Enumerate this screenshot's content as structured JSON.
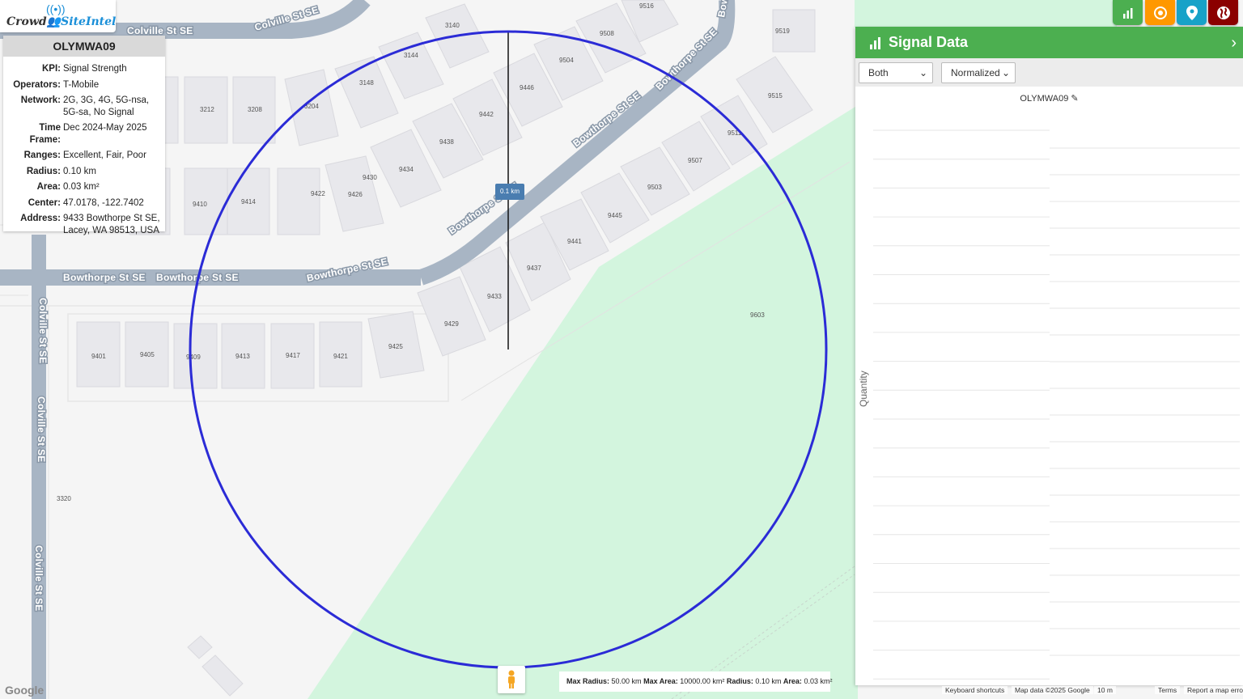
{
  "app": {
    "logo_left": "Crowd",
    "logo_right": "SiteIntel"
  },
  "info": {
    "title": "OLYMWA09",
    "rows": [
      {
        "k": "KPI:",
        "v": "Signal Strength"
      },
      {
        "k": "Operators:",
        "v": "T-Mobile"
      },
      {
        "k": "Network:",
        "v": "2G, 3G, 4G, 5G-nsa, 5G-sa, No Signal"
      },
      {
        "k": "Time Frame:",
        "v": "Dec 2024-May 2025"
      },
      {
        "k": "Ranges:",
        "v": "Excellent, Fair, Poor"
      },
      {
        "k": "Radius:",
        "v": "0.10 km"
      },
      {
        "k": "Area:",
        "v": "0.03 km²"
      },
      {
        "k": "Center:",
        "v": "47.0178, -122.7402"
      },
      {
        "k": "Address:",
        "v": "9433 Bowthorpe St SE, Lacey, WA 98513, USA"
      }
    ]
  },
  "toolbar": {
    "buttons": [
      {
        "name": "chart-icon",
        "color": "#4caf50"
      },
      {
        "name": "target-icon",
        "color": "#ff9800"
      },
      {
        "name": "location-pin-icon",
        "color": "#17a2c8"
      },
      {
        "name": "globe-icon",
        "color": "#8b0000"
      }
    ]
  },
  "panel": {
    "title": "Signal Data",
    "select_mode": "Both",
    "select_scale": "Normalized",
    "chart_title": "OLYMWA09",
    "ylabel": "Quantity"
  },
  "map": {
    "streets": {
      "colville_top_1": "Colville St SE",
      "colville_top_2": "Colville St SE",
      "bowthorpe_1": "Bowthorpe St SE",
      "bowthorpe_2": "Bowthorpe St SE",
      "bowthorpe_3": "Bowthorpe St SE",
      "bowthorpe_diag_1": "Bowthorpe St SE",
      "bowthorpe_diag_2": "Bowthorpe St SE",
      "bowthorpe_diag_3": "Bowthorpe St SE",
      "bowthorpe_vert": "Bow",
      "colville_vert_1": "Colville St SE",
      "colville_vert_2": "Colville St SE",
      "colville_vert_3": "Colville St SE"
    },
    "measure_label": "0.1 km",
    "house_numbers": [
      "3140",
      "3144",
      "3148",
      "3204",
      "3212",
      "3208",
      "9516",
      "9508",
      "9504",
      "9446",
      "9442",
      "9438",
      "9434",
      "9430",
      "9426",
      "9422",
      "9414",
      "9410",
      "9519",
      "9515",
      "9511",
      "9507",
      "9503",
      "9445",
      "9441",
      "9437",
      "9433",
      "9429",
      "9425",
      "9421",
      "9417",
      "9413",
      "9409",
      "9405",
      "9401",
      "9603",
      "3320"
    ]
  },
  "stats": {
    "max_radius_label": "Max Radius:",
    "max_radius": "50.00 km",
    "max_area_label": "Max Area:",
    "max_area": "10000.00 km²",
    "radius_label": "Radius:",
    "radius": "0.10 km",
    "area_label": "Area:",
    "area": "0.03 km²"
  },
  "attribution": {
    "google": "Google",
    "shortcuts": "Keyboard shortcuts",
    "mapdata": "Map data ©2025 Google",
    "scale": "10 m",
    "terms": "Terms",
    "report": "Report a map error"
  }
}
